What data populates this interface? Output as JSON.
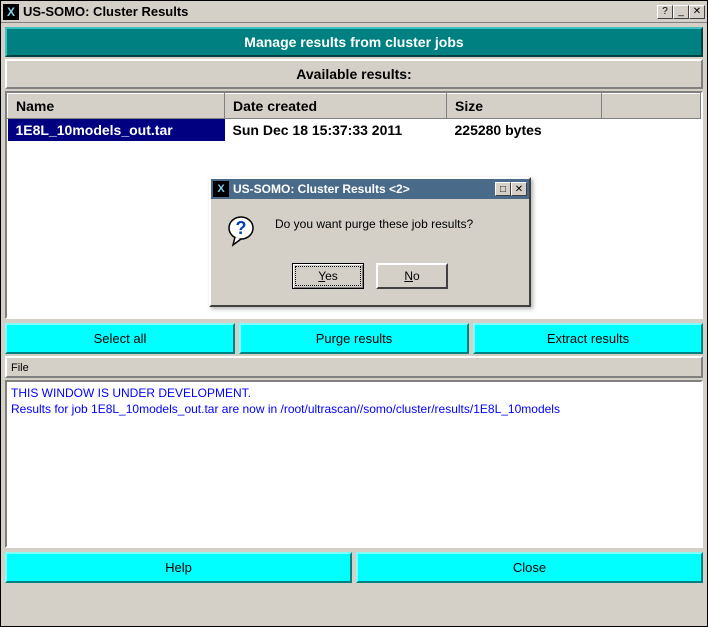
{
  "window": {
    "title": "US-SOMO: Cluster Results"
  },
  "headers": {
    "main": "Manage results from cluster jobs",
    "available": "Available results:"
  },
  "table": {
    "columns": {
      "name": "Name",
      "date": "Date created",
      "size": "Size"
    },
    "rows": [
      {
        "name": "1E8L_10models_out.tar",
        "date": "Sun Dec 18 15:37:33 2011",
        "size": "225280 bytes"
      }
    ]
  },
  "buttons": {
    "select_all": "Select all",
    "purge": "Purge results",
    "extract": "Extract results",
    "help": "Help",
    "close": "Close"
  },
  "menu": {
    "file": "File"
  },
  "log": {
    "line1": "THIS WINDOW IS UNDER DEVELOPMENT.",
    "line2": "Results for job 1E8L_10models_out.tar are now in /root/ultrascan//somo/cluster/results/1E8L_10models"
  },
  "dialog": {
    "title": "US-SOMO: Cluster Results <2>",
    "message": "Do you want purge these job results?",
    "yes": "Yes",
    "no": "No"
  }
}
